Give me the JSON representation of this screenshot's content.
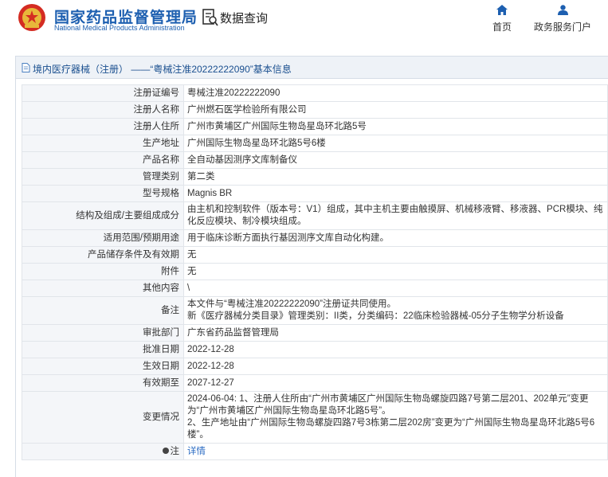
{
  "header": {
    "site_name_cn": "国家药品监督管理局",
    "site_name_en": "National Medical Products Administration",
    "query_label": "数据查询",
    "nav": [
      {
        "label": "首页",
        "icon": "home-icon"
      },
      {
        "label": "政务服务门户",
        "icon": "user-icon"
      }
    ]
  },
  "panel": {
    "title": "境内医疗器械（注册） ——“粤械注准20222222090”基本信息",
    "title_icon": "document-icon"
  },
  "rows": [
    {
      "key": "注册证编号",
      "value": "粤械注准20222222090"
    },
    {
      "key": "注册人名称",
      "value": "广州燃石医学检验所有限公司"
    },
    {
      "key": "注册人住所",
      "value": "广州市黄埔区广州国际生物岛星岛环北路5号"
    },
    {
      "key": "生产地址",
      "value": "广州国际生物岛星岛环北路5号6楼"
    },
    {
      "key": "产品名称",
      "value": "全自动基因测序文库制备仪"
    },
    {
      "key": "管理类别",
      "value": "第二类"
    },
    {
      "key": "型号规格",
      "value": "Magnis BR"
    },
    {
      "key": "结构及组成/主要组成成分",
      "value": "由主机和控制软件（版本号：V1）组成，其中主机主要由触摸屏、机械移液臂、移液器、PCR模块、纯化反应模块、制冷模块组成。"
    },
    {
      "key": "适用范围/预期用途",
      "value": "用于临床诊断方面执行基因测序文库自动化构建。"
    },
    {
      "key": "产品储存条件及有效期",
      "value": "无"
    },
    {
      "key": "附件",
      "value": "无"
    },
    {
      "key": "其他内容",
      "value": "\\"
    },
    {
      "key": "备注",
      "value": "本文件与“粤械注准20222222090”注册证共同使用。\n新《医疗器械分类目录》管理类别：II类，分类编码：22临床检验器械-05分子生物学分析设备"
    },
    {
      "key": "审批部门",
      "value": "广东省药品监督管理局"
    },
    {
      "key": "批准日期",
      "value": "2022-12-28"
    },
    {
      "key": "生效日期",
      "value": "2022-12-28"
    },
    {
      "key": "有效期至",
      "value": "2027-12-27"
    },
    {
      "key": "变更情况",
      "value": "2024-06-04: 1、注册人住所由“广州市黄埔区广州国际生物岛螺旋四路7号第二层201、202单元”变更为“广州市黄埔区广州国际生物岛星岛环北路5号”。\n2、生产地址由“广州国际生物岛螺旋四路7号3栋第二层202房”变更为“广州国际生物岛星岛环北路5号6楼”。"
    }
  ],
  "note_row": {
    "key": "注",
    "key_icon": "pin-icon",
    "link": "详情"
  },
  "colors": {
    "brand": "#1d5fb0",
    "title_bg": "#eef2f7",
    "key_bg": "#f4f6f9",
    "link": "#2a6bc3"
  }
}
